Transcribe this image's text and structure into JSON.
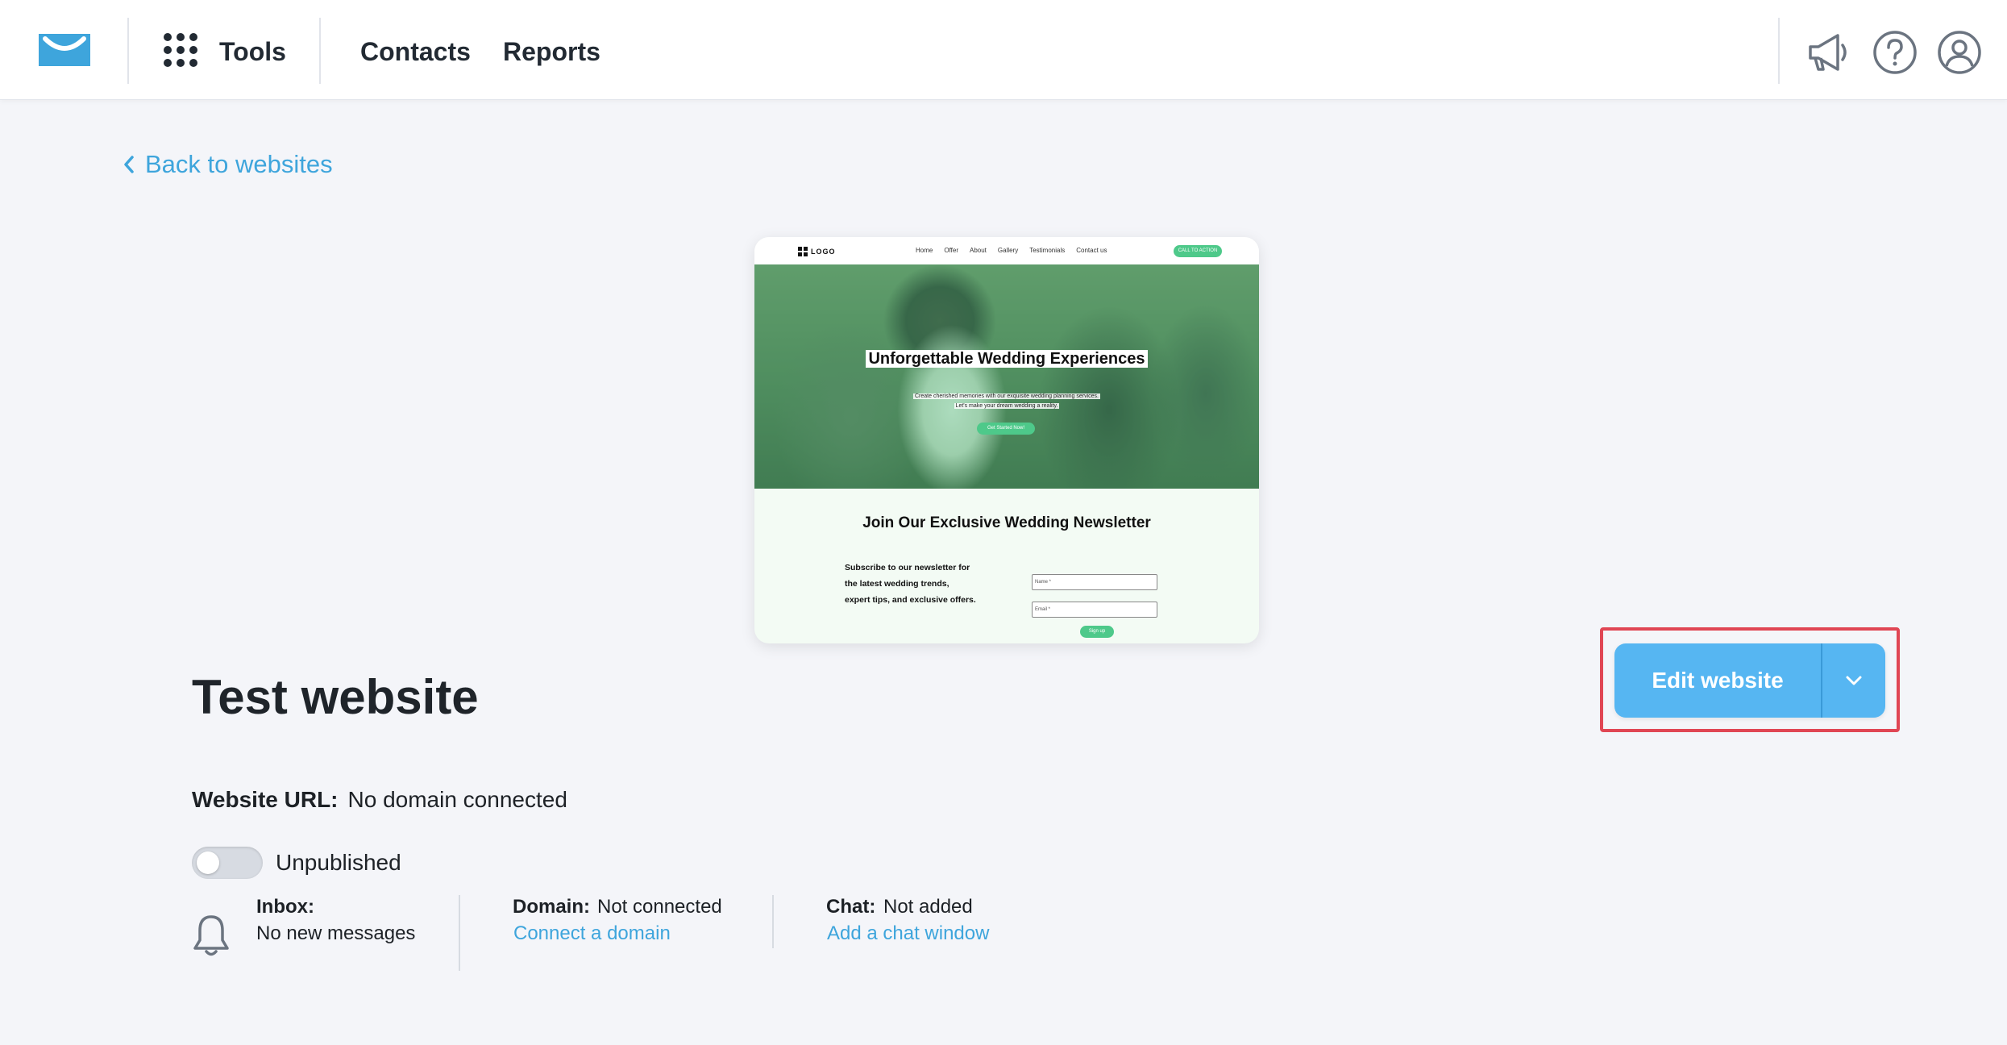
{
  "header": {
    "tools_label": "Tools",
    "nav": [
      "Contacts",
      "Reports"
    ],
    "icons": [
      "getresponse-logo-icon",
      "grid-dots-icon",
      "megaphone-icon",
      "help-icon",
      "user-account-icon"
    ]
  },
  "back_link": "Back to websites",
  "preview": {
    "logo": "LOGO",
    "nav_links": [
      "Home",
      "Offer",
      "About",
      "Gallery",
      "Testimonials",
      "Contact us"
    ],
    "nav_cta": "CALL TO ACTION",
    "hero_title": "Unforgettable Wedding Experiences",
    "hero_sub_1": "Create cherished memories with our exquisite wedding planning services.",
    "hero_sub_2": "Let's make your dream wedding a reality.",
    "hero_button": "Get Started Now!",
    "newsletter_title": "Join Our Exclusive Wedding Newsletter",
    "newsletter_text_1": "Subscribe to our newsletter for",
    "newsletter_text_2": "the latest wedding trends,",
    "newsletter_text_3": "expert tips, and exclusive offers.",
    "name_placeholder": "Name *",
    "email_placeholder": "Email *",
    "signup": "Sign up"
  },
  "site": {
    "title": "Test website",
    "url_label": "Website URL:",
    "url_value": "No domain connected",
    "status": "Unpublished",
    "published": false
  },
  "info": {
    "inbox_title": "Inbox:",
    "inbox_text": "No new messages",
    "domain_title": "Domain:",
    "domain_status": "Not connected",
    "domain_link": "Connect a domain",
    "chat_title": "Chat:",
    "chat_status": "Not added",
    "chat_link": "Add a chat window"
  },
  "actions": {
    "edit_label": "Edit website"
  },
  "colors": {
    "accent": "#3ea5dc",
    "primary_button": "#56b6f2",
    "highlight": "#e04654",
    "preview_green": "#4ec98a"
  }
}
